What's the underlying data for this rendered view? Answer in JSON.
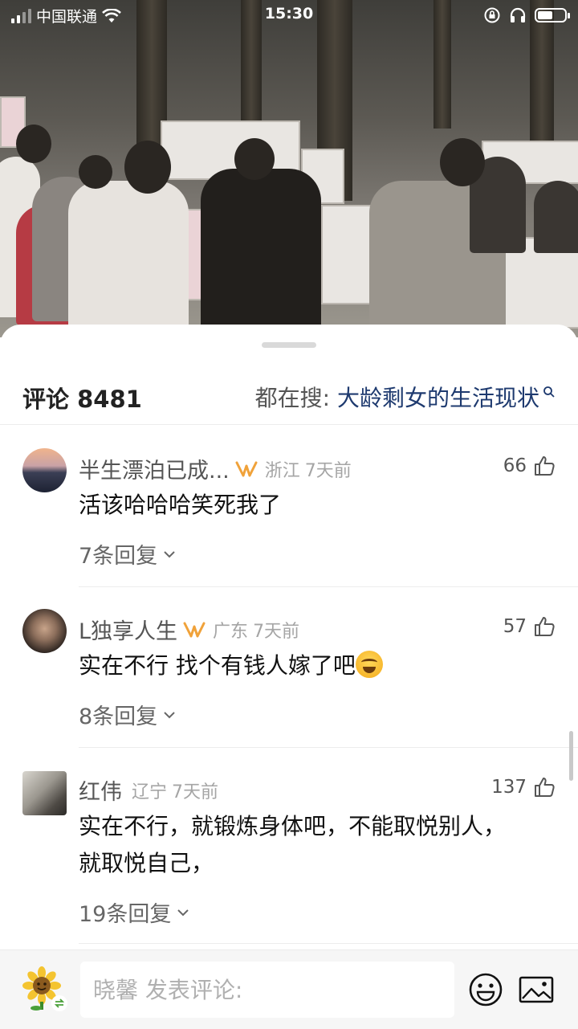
{
  "status_bar": {
    "carrier": "中国联通",
    "time": "15:30",
    "battery_fraction": 0.55
  },
  "header": {
    "comments_label": "评论 8481",
    "search_prefix": "都在搜: ",
    "search_keyword": "大龄剩女的生活现状"
  },
  "comments": [
    {
      "name": "半生漂泊已成...",
      "location": "浙江",
      "time": "7天前",
      "likes": "66",
      "text": "活该哈哈哈笑死我了",
      "replies": "7条回复",
      "has_vip": true
    },
    {
      "name": "L独享人生",
      "location": "广东",
      "time": "7天前",
      "likes": "57",
      "text": "实在不行 找个有钱人嫁了吧",
      "replies": "8条回复",
      "has_vip": true
    },
    {
      "name": "红伟",
      "location": "辽宁",
      "time": "7天前",
      "likes": "137",
      "text_line1": "实在不行，就锻炼身体吧，不能取悦别人，",
      "text_line2": "就取悦自己，",
      "replies": "19条回复",
      "has_vip": false
    }
  ],
  "composer": {
    "placeholder": "晓馨 发表评论:"
  },
  "icons": [
    "wifi-icon",
    "battery-icon",
    "headphones-icon",
    "rotation-lock-icon",
    "search-icon",
    "vip-icon",
    "like-icon",
    "chevron-down-icon",
    "emoji-icon",
    "image-icon"
  ],
  "colors": {
    "keyword": "#1e3a6f",
    "vip": "#f0a23a",
    "meta": "#a5a5a5"
  }
}
